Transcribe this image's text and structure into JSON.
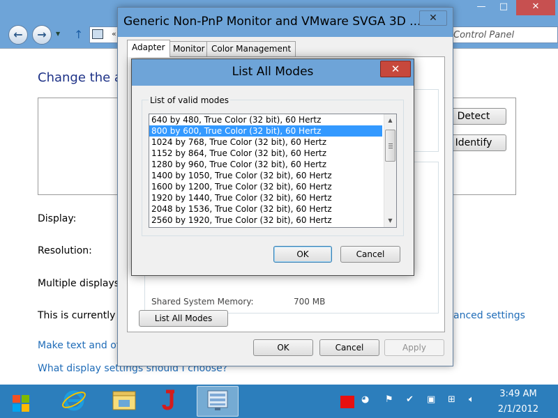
{
  "background_window": {
    "address_chevron": "«",
    "address_text": "Control Panel",
    "page_title": "Change the a",
    "detect_label": "Detect",
    "identify_label": "Identify",
    "display_label": "Display:",
    "resolution_label": "Resolution:",
    "multiple_displays_label": "Multiple displays:",
    "currently_text": "This is currently yo",
    "advanced_link": "anced settings",
    "make_text_link": "Make text and oth",
    "which_settings_link": "What display settings should I choose?"
  },
  "properties_dialog": {
    "title": "Generic Non-PnP Monitor and VMware SVGA 3D ...",
    "tabs": [
      {
        "label": "Adapter",
        "active": true
      },
      {
        "label": "Monitor",
        "active": false
      },
      {
        "label": "Color Management",
        "active": false
      }
    ],
    "shared_memory_label": "Shared System Memory:",
    "shared_memory_value": "700 MB",
    "list_all_modes_label": "List All Modes",
    "ok_label": "OK",
    "cancel_label": "Cancel",
    "apply_label": "Apply"
  },
  "modes_dialog": {
    "title": "List All Modes",
    "group_label": "List of valid modes",
    "modes": [
      "640 by 480, True Color (32 bit), 60 Hertz",
      "800 by 600, True Color (32 bit), 60 Hertz",
      "1024 by 768, True Color (32 bit), 60 Hertz",
      "1152 by 864, True Color (32 bit), 60 Hertz",
      "1280 by 960, True Color (32 bit), 60 Hertz",
      "1400 by 1050, True Color (32 bit), 60 Hertz",
      "1600 by 1200, True Color (32 bit), 60 Hertz",
      "1920 by 1440, True Color (32 bit), 60 Hertz",
      "2048 by 1536, True Color (32 bit), 60 Hertz",
      "2560 by 1920, True Color (32 bit), 60 Hertz"
    ],
    "selected_index": 1,
    "ok_label": "OK",
    "cancel_label": "Cancel"
  },
  "taskbar": {
    "apps": [
      {
        "name": "internet-explorer",
        "icon": "ie-icon",
        "active": false
      },
      {
        "name": "file-explorer",
        "icon": "folder-icon",
        "active": false
      },
      {
        "name": "j-app",
        "icon": "j-letter-icon",
        "active": false
      },
      {
        "name": "control-panel",
        "icon": "control-panel-icon",
        "active": true
      }
    ],
    "clock_time": "3:49 AM",
    "clock_date": "2/1/2012"
  },
  "colors": {
    "titlebar": "#6ea4d8",
    "selection": "#3399ff",
    "taskbar": "#2c7ebc",
    "close_red": "#c7483c",
    "link": "#1f6cb8"
  }
}
